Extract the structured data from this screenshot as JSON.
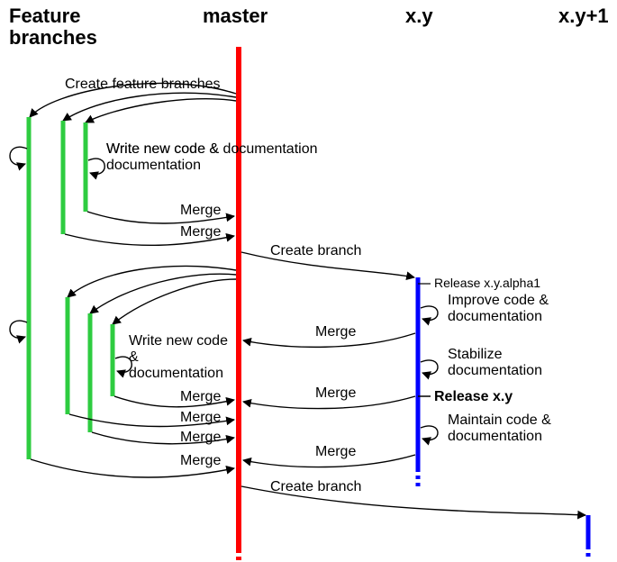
{
  "headers": {
    "feature": "Feature",
    "branches": "branches",
    "master": "master",
    "xy": "x.y",
    "xy1": "x.y+1"
  },
  "labels": {
    "create_feature_branches": "Create feature branches",
    "write_new_code_doc": "Write new code & documentation",
    "merge": "Merge",
    "create_branch": "Create branch",
    "release_alpha1": "Release x.y.alpha1",
    "improve_code_doc": "Improve code & documentation",
    "stabilize_doc": "Stabilize documentation",
    "release_xy": "Release x.y",
    "maintain_code_doc": "Maintain code & documentation"
  },
  "colors": {
    "feature": "#2ecc40",
    "master": "#ff0000",
    "release": "#0000ff",
    "stroke": "#000000"
  }
}
